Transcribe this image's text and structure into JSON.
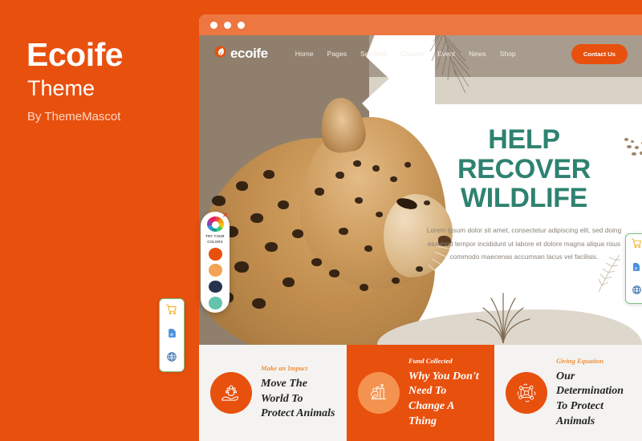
{
  "brand": {
    "title": "Ecoife",
    "subtitle": "Theme",
    "author": "By ThemeMascot",
    "bg_color": "#e8500e"
  },
  "window": {
    "titlebar_color": "#ed7740",
    "dots": 3
  },
  "navbar": {
    "logo_text": "ecoife",
    "logo_icon": "leaf-icon",
    "links": [
      {
        "label": "Home"
      },
      {
        "label": "Pages"
      },
      {
        "label": "Services"
      },
      {
        "label": "Causes"
      },
      {
        "label": "Event"
      },
      {
        "label": "News"
      },
      {
        "label": "Shop"
      }
    ],
    "contact_label": "Contact Us"
  },
  "hero": {
    "heading_line1": "HELP",
    "heading_line2": "RECOVER",
    "heading_line3": "WILDLIFE",
    "heading_color": "#2e8270",
    "paragraph": "Lorem ipsum dolor sit amet, consectetur adipiscing elit, sed doing eiusmod tempor incididunt ut labore et dolore magna aliqua risus commodo maecenas accumsan lacus vel facilisis.",
    "image_subject": "leopard"
  },
  "cards": [
    {
      "eyebrow": "Make an Impact",
      "title": "Move The World To Protect Animals",
      "icon": "hand-holding-paw-icon",
      "style": "light"
    },
    {
      "eyebrow": "Fund Collected",
      "title": "Why You Don't Need To Change A Thing",
      "icon": "fund-chart-icon",
      "style": "accent"
    },
    {
      "eyebrow": "Giving Equation",
      "title": "Our Determination To Protect Animals",
      "icon": "giving-network-icon",
      "style": "light"
    }
  ],
  "color_picker": {
    "label_line1": "TRY YOUR",
    "label_line2": "COLORS",
    "close_glyph": "✕",
    "wheel_icon": "color-wheel-icon",
    "swatches": [
      {
        "name": "orange",
        "hex": "#e8500e"
      },
      {
        "name": "light-orange",
        "hex": "#f4a254"
      },
      {
        "name": "navy",
        "hex": "#25354f"
      },
      {
        "name": "teal",
        "hex": "#63c4ab"
      }
    ]
  },
  "float_buttons": [
    {
      "name": "cart-icon",
      "color": "#f5b731"
    },
    {
      "name": "document-icon",
      "color": "#4a90e2"
    },
    {
      "name": "globe-icon",
      "color": "#3b6fb0"
    }
  ],
  "mini_preview": {
    "paragraph": "adipiscing elit, sed doing eiusmod tempor incididunt ut labore et dolore magna aliqua risus commodo maecenas accumsan lacus vel facilisis.",
    "card": {
      "eyebrow": "Make an Impact",
      "title": "Move The World To Protect Animals",
      "icon": "hand-holding-paw-icon"
    }
  }
}
